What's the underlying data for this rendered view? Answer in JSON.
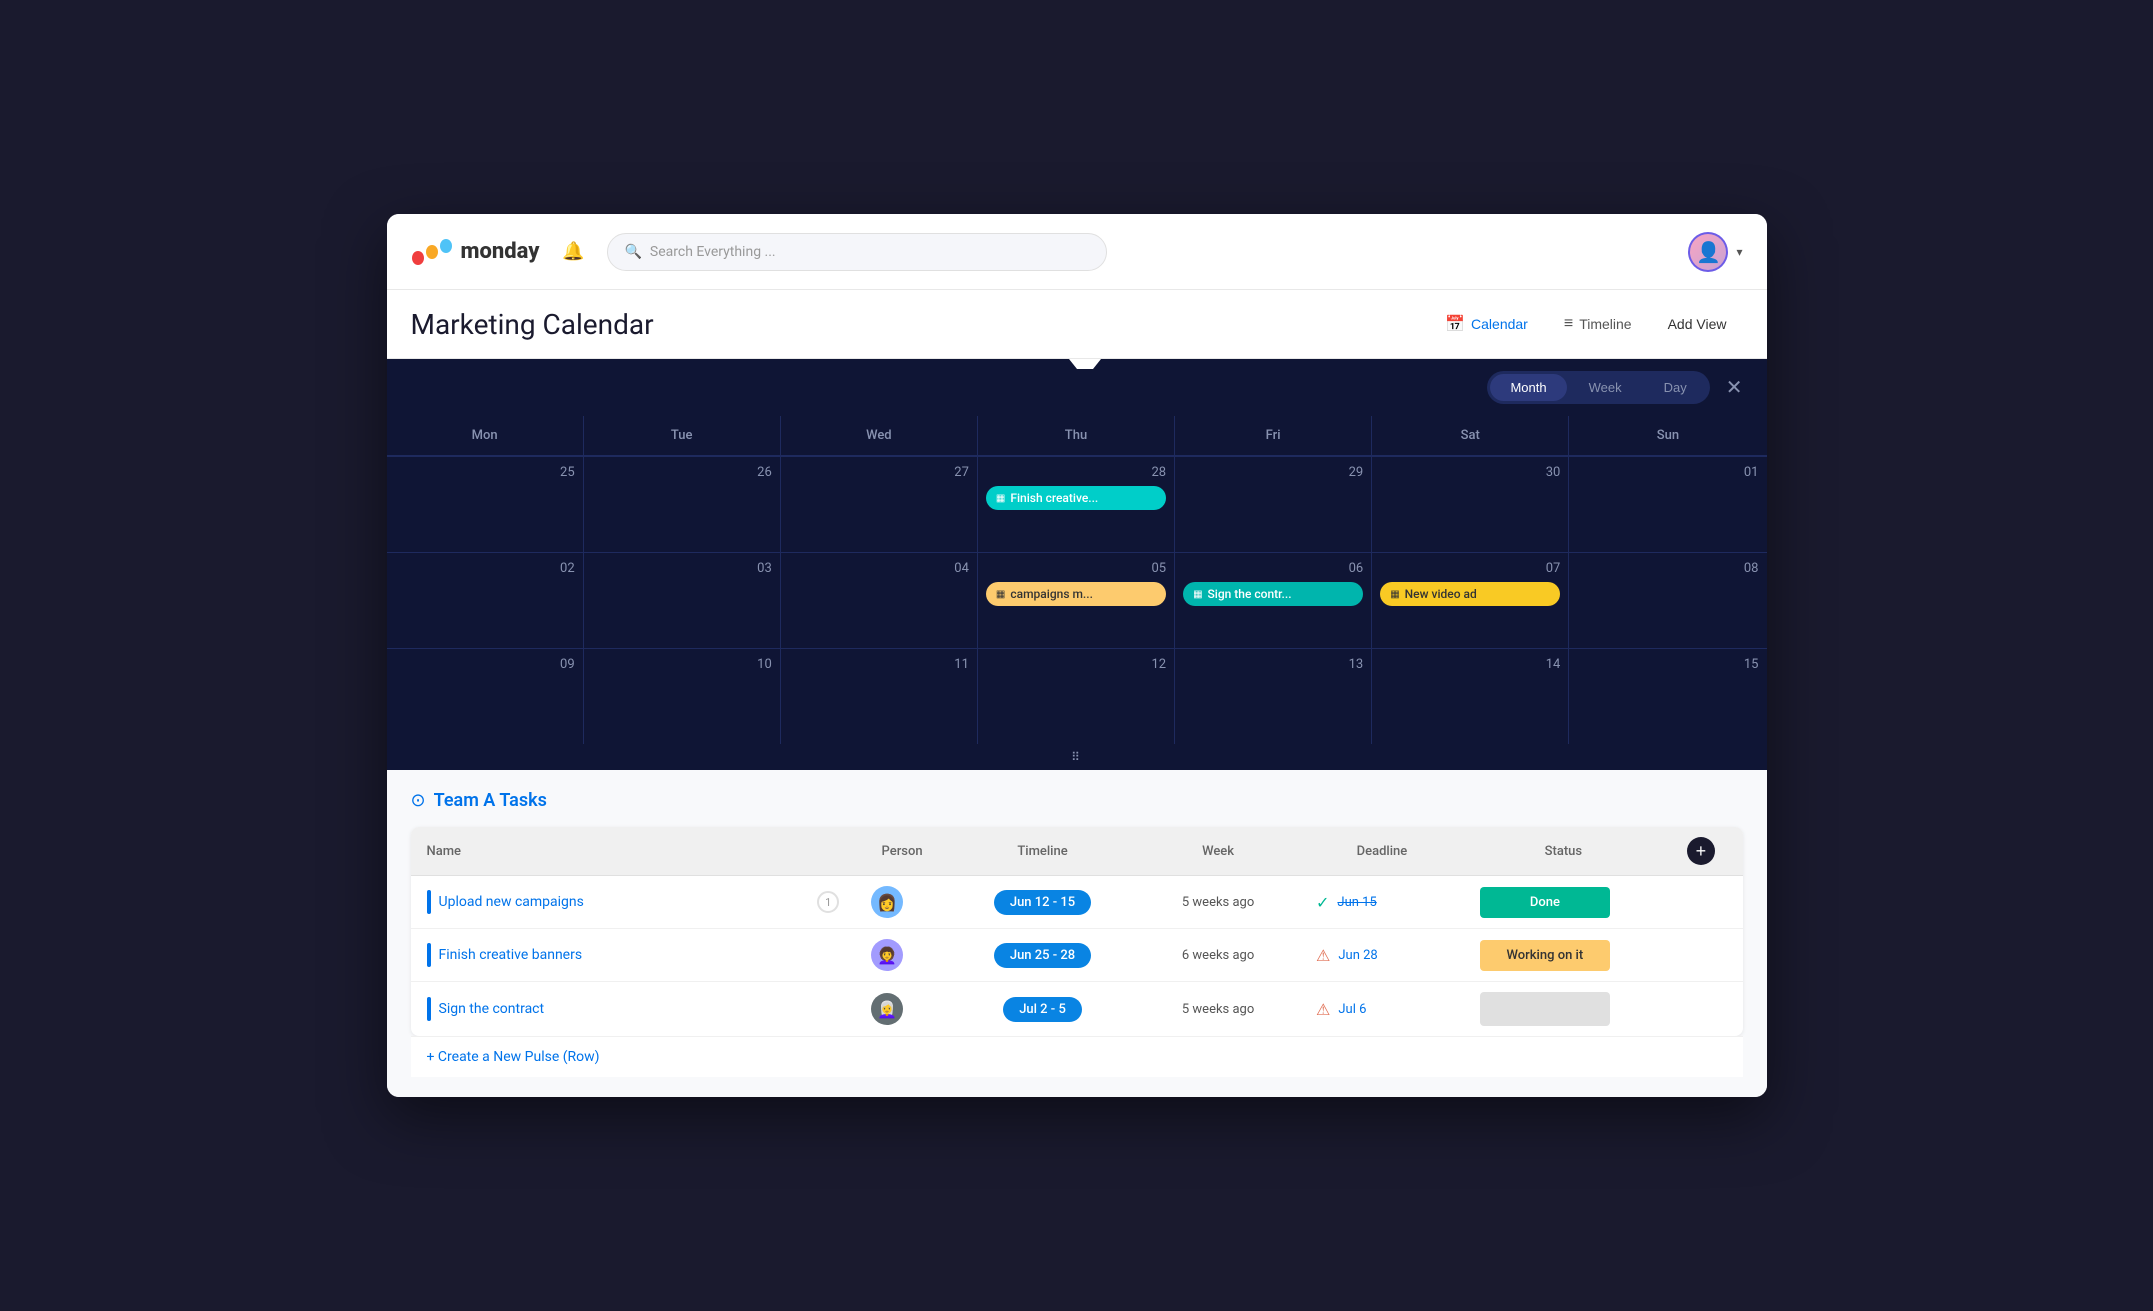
{
  "app": {
    "name": "monday",
    "title": "Marketing Calendar"
  },
  "header": {
    "search_placeholder": "Search Everything ...",
    "bell_label": "Notifications",
    "avatar_label": "User avatar"
  },
  "view_tabs": {
    "calendar_label": "Calendar",
    "timeline_label": "Timeline",
    "add_view_label": "Add View"
  },
  "calendar": {
    "view_month": "Month",
    "view_week": "Week",
    "view_day": "Day",
    "days": [
      "Mon",
      "Tue",
      "Wed",
      "Thu",
      "Fri",
      "Sat",
      "Sun"
    ],
    "weeks": [
      {
        "dates": [
          "25",
          "26",
          "27",
          "28",
          "29",
          "30",
          "01"
        ],
        "events": [
          {
            "day": 3,
            "label": "Finish creative...",
            "color": "cyan"
          }
        ]
      },
      {
        "dates": [
          "02",
          "03",
          "04",
          "05",
          "06",
          "07",
          "08"
        ],
        "events": [
          {
            "day": 3,
            "label": "campaigns m...",
            "color": "yellow"
          },
          {
            "day": 4,
            "label": "Sign the contr...",
            "color": "teal"
          },
          {
            "day": 5,
            "label": "New video ad",
            "color": "yellow2"
          }
        ]
      },
      {
        "dates": [
          "09",
          "10",
          "11",
          "12",
          "13",
          "14",
          "15"
        ],
        "events": []
      }
    ]
  },
  "tasks": {
    "section_title": "Team A Tasks",
    "columns": {
      "name": "Name",
      "person": "Person",
      "timeline": "Timeline",
      "week": "Week",
      "deadline": "Deadline",
      "status": "Status"
    },
    "rows": [
      {
        "name": "Upload new campaigns",
        "person_color": "blue",
        "person_emoji": "👩",
        "timeline": "Jun 12 - 15",
        "week": "5 weeks ago",
        "deadline_icon": "check",
        "deadline": "Jun 15",
        "deadline_strikethrough": true,
        "status": "Done",
        "status_type": "done",
        "badge": "1"
      },
      {
        "name": "Finish creative banners",
        "person_color": "purple",
        "person_emoji": "👩‍🦱",
        "timeline": "Jun 25 - 28",
        "week": "6 weeks ago",
        "deadline_icon": "alert",
        "deadline": "Jun 28",
        "deadline_strikethrough": false,
        "status": "Working on it",
        "status_type": "working",
        "badge": ""
      },
      {
        "name": "Sign the contract",
        "person_color": "dark",
        "person_emoji": "👩‍🦳",
        "timeline": "Jul 2 - 5",
        "week": "5 weeks ago",
        "deadline_icon": "alert",
        "deadline": "Jul 6",
        "deadline_strikethrough": false,
        "status": "",
        "status_type": "empty",
        "badge": ""
      }
    ],
    "add_row_label": "+ Create a New Pulse (Row)"
  }
}
